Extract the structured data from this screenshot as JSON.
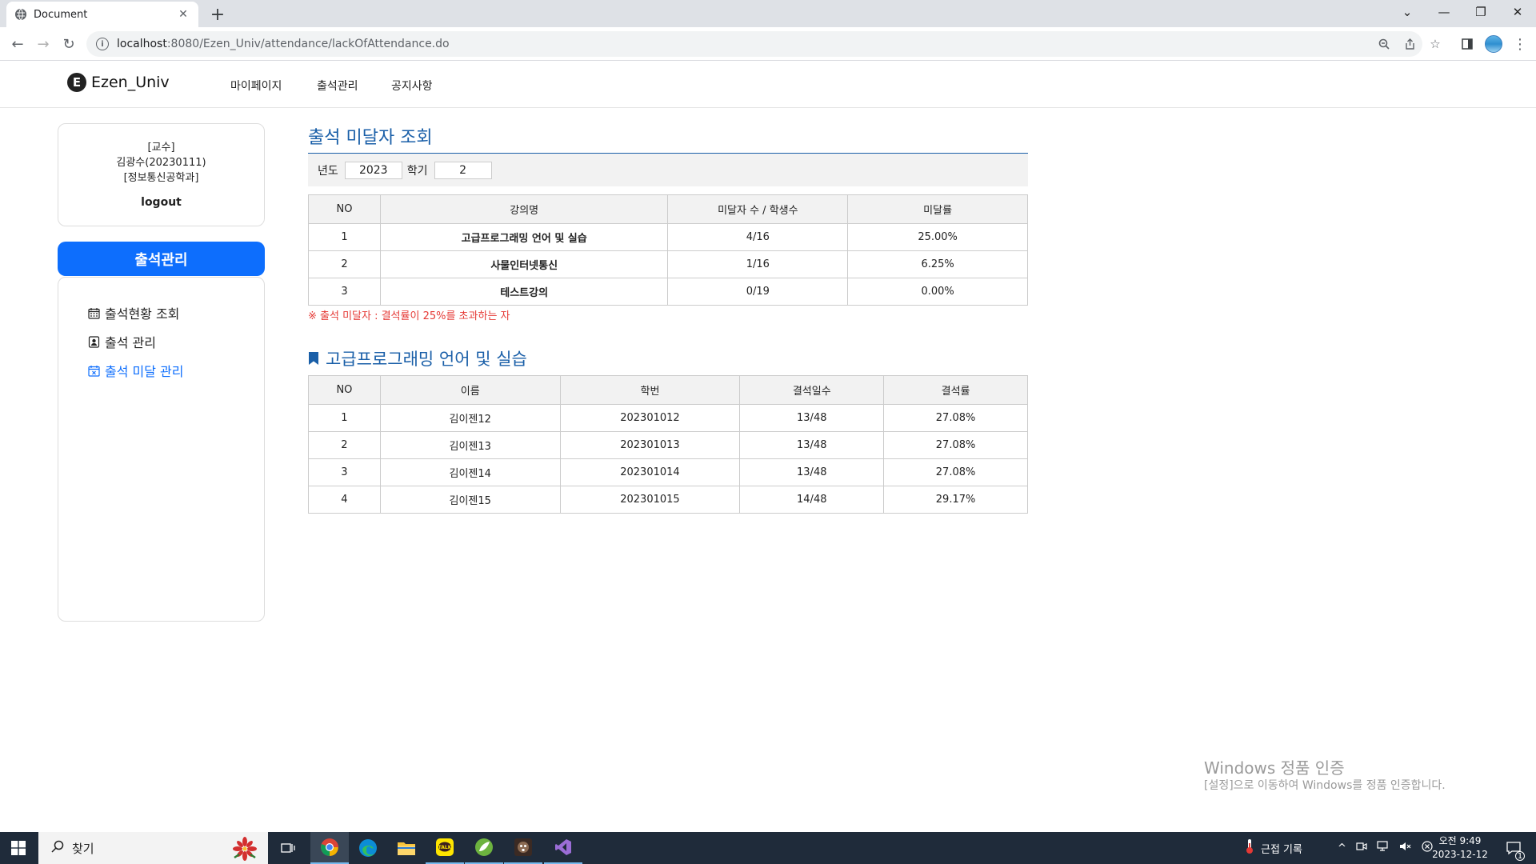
{
  "browser": {
    "tab_title": "Document",
    "new_tab": "+",
    "url_host": "localhost",
    "url_path": ":8080/Ezen_Univ/attendance/lackOfAttendance.do"
  },
  "header": {
    "logo_letter": "E",
    "logo_text": "Ezen_Univ",
    "nav": [
      "마이페이지",
      "출석관리",
      "공지사항"
    ]
  },
  "profile": {
    "role": "[교수]",
    "name": "김광수(20230111)",
    "dept": "[정보통신공학과]",
    "logout": "logout"
  },
  "sidebar": {
    "title": "출석관리",
    "items": [
      {
        "label": "출석현황 조회",
        "icon": "calendar-icon"
      },
      {
        "label": "출석 관리",
        "icon": "person-badge-icon"
      },
      {
        "label": "출석 미달 관리",
        "icon": "calendar-x-icon"
      }
    ]
  },
  "main": {
    "title": "출석 미달자 조회",
    "filter": {
      "year_label": "년도",
      "year_value": "2023",
      "semester_label": "학기",
      "semester_value": "2"
    },
    "course_table": {
      "headers": [
        "NO",
        "강의명",
        "미달자 수 / 학생수",
        "미달률"
      ],
      "rows": [
        [
          "1",
          "고급프로그래밍 언어 및 실습",
          "4/16",
          "25.00%"
        ],
        [
          "2",
          "사물인터넷통신",
          "1/16",
          "6.25%"
        ],
        [
          "3",
          "테스트강의",
          "0/19",
          "0.00%"
        ]
      ]
    },
    "note": "※ 출석 미달자 : 결석률이 25%를 초과하는 자",
    "sub_title": "고급프로그래밍 언어 및 실습",
    "student_table": {
      "headers": [
        "NO",
        "이름",
        "학번",
        "결석일수",
        "결석률"
      ],
      "rows": [
        [
          "1",
          "김이젠12",
          "202301012",
          "13/48",
          "27.08%"
        ],
        [
          "2",
          "김이젠13",
          "202301013",
          "13/48",
          "27.08%"
        ],
        [
          "3",
          "김이젠14",
          "202301014",
          "13/48",
          "27.08%"
        ],
        [
          "4",
          "김이젠15",
          "202301015",
          "14/48",
          "29.17%"
        ]
      ]
    }
  },
  "watermark": {
    "line1": "Windows 정품 인증",
    "line2": "[설정]으로 이동하여 Windows를 정품 인증합니다."
  },
  "taskbar": {
    "search_placeholder": "찾기",
    "weather": "근접 기록",
    "time": "오전 9:49",
    "date": "2023-12-12",
    "notif_count": "1"
  },
  "colors": {
    "accent": "#0d6efd",
    "title_blue": "#1a5fa8",
    "note_red": "#e53935"
  }
}
